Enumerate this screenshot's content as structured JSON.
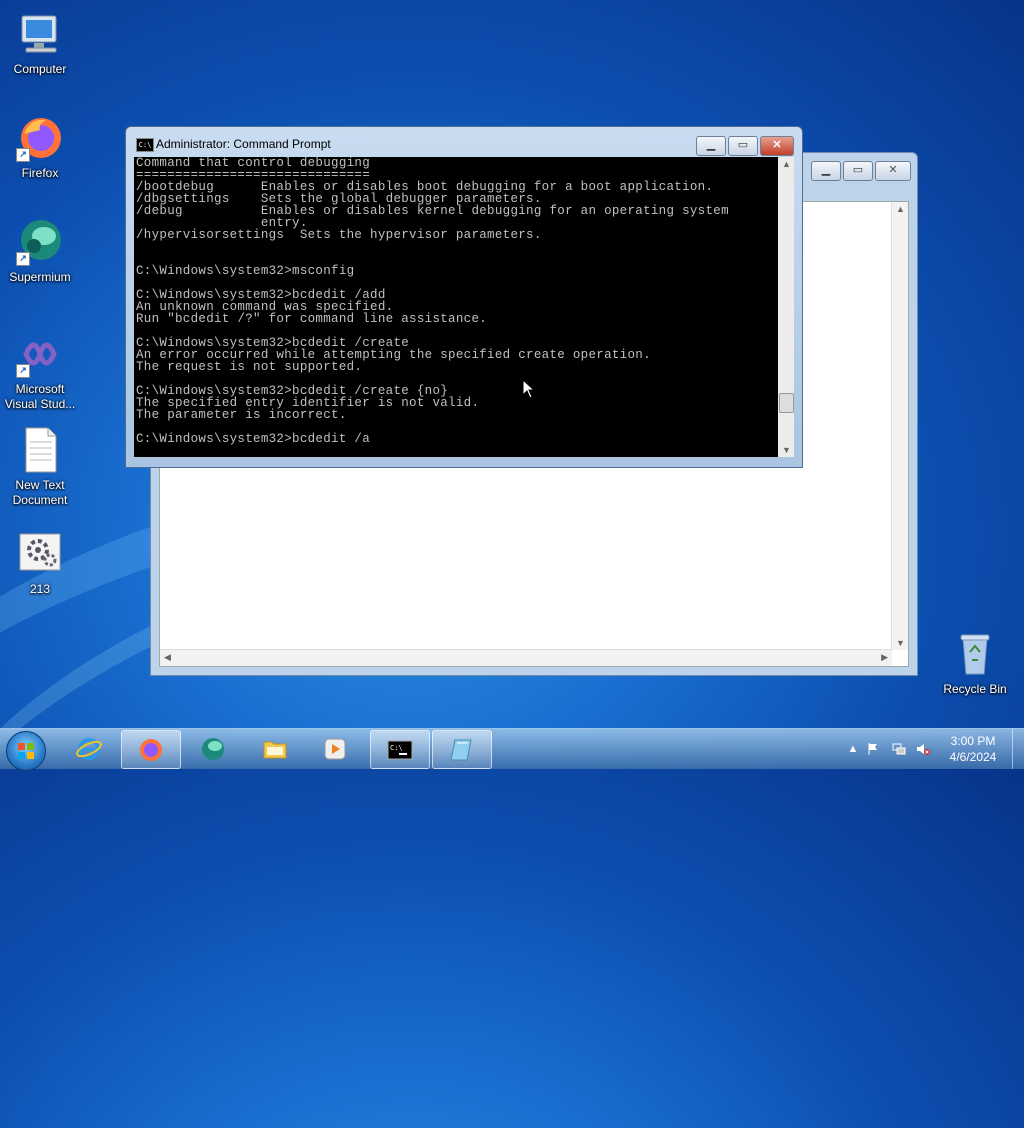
{
  "desktop": {
    "icons": [
      {
        "label": "Computer",
        "icon": "computer-icon"
      },
      {
        "label": "Firefox",
        "icon": "firefox-icon"
      },
      {
        "label": "Supermium",
        "icon": "supermium-icon"
      },
      {
        "label": "Microsoft Visual Stud...",
        "icon": "visual-studio-icon"
      },
      {
        "label": "New Text Document",
        "icon": "text-document-icon"
      },
      {
        "label": "213",
        "icon": "settings-file-icon"
      },
      {
        "label": "Recycle Bin",
        "icon": "recycle-bin-icon"
      }
    ]
  },
  "cmd_window": {
    "title": "Administrator: Command Prompt",
    "lines": [
      "Command that control debugging",
      "==============================",
      "/bootdebug      Enables or disables boot debugging for a boot application.",
      "/dbgsettings    Sets the global debugger parameters.",
      "/debug          Enables or disables kernel debugging for an operating system",
      "                entry.",
      "/hypervisorsettings  Sets the hypervisor parameters.",
      "",
      "",
      "C:\\Windows\\system32>msconfig",
      "",
      "C:\\Windows\\system32>bcdedit /add",
      "An unknown command was specified.",
      "Run \"bcdedit /?\" for command line assistance.",
      "",
      "C:\\Windows\\system32>bcdedit /create",
      "An error occurred while attempting the specified create operation.",
      "The request is not supported.",
      "",
      "C:\\Windows\\system32>bcdedit /create {no}",
      "The specified entry identifier is not valid.",
      "The parameter is incorrect.",
      "",
      "C:\\Windows\\system32>bcdedit /a"
    ]
  },
  "taskbar": {
    "items": [
      {
        "name": "internet-explorer",
        "active": false
      },
      {
        "name": "firefox",
        "active": true
      },
      {
        "name": "supermium",
        "active": false
      },
      {
        "name": "file-explorer",
        "active": false
      },
      {
        "name": "media-player",
        "active": false
      },
      {
        "name": "command-prompt",
        "active": true
      },
      {
        "name": "notepad",
        "active": true
      }
    ],
    "clock": {
      "time": "3:00 PM",
      "date": "4/6/2024"
    }
  },
  "colors": {
    "desktop_blue": "#1a6fd0",
    "console_bg": "#000000",
    "console_fg": "#c0c0c0"
  }
}
